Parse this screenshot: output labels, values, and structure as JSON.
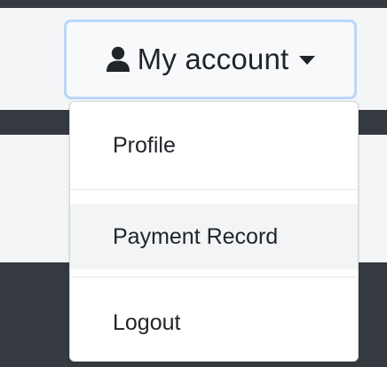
{
  "account_button": {
    "label": "My account",
    "icon": "user-icon",
    "caret_icon": "caret-down-icon"
  },
  "menu": {
    "items": [
      {
        "label": "Profile"
      },
      {
        "label": "Payment Record"
      },
      {
        "label": "Logout"
      }
    ]
  },
  "colors": {
    "dark_bg": "#343a40",
    "button_focus_border": "#b9d6fb",
    "text": "#212529",
    "hover_bg": "#f3f4f5"
  }
}
